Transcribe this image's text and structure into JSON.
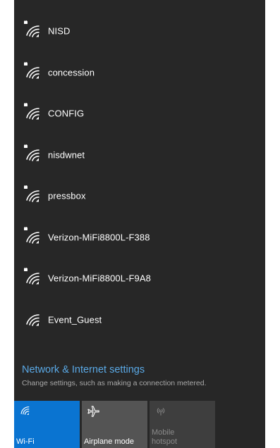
{
  "networks": [
    {
      "name": "NISD",
      "secured": true,
      "icon": "wifi-lock-icon"
    },
    {
      "name": "concession",
      "secured": true,
      "icon": "wifi-lock-icon"
    },
    {
      "name": "CONFIG",
      "secured": true,
      "icon": "wifi-lock-icon"
    },
    {
      "name": "nisdwnet",
      "secured": true,
      "icon": "wifi-lock-icon"
    },
    {
      "name": "pressbox",
      "secured": true,
      "icon": "wifi-lock-icon"
    },
    {
      "name": "Verizon-MiFi8800L-F388",
      "secured": true,
      "icon": "wifi-lock-icon"
    },
    {
      "name": "Verizon-MiFi8800L-F9A8",
      "secured": true,
      "icon": "wifi-lock-icon"
    },
    {
      "name": "Event_Guest",
      "secured": false,
      "icon": "wifi-icon"
    }
  ],
  "settings": {
    "link": "Network & Internet settings",
    "description": "Change settings, such as making a connection metered."
  },
  "quick_actions": {
    "wifi": {
      "label": "Wi-Fi",
      "active": true,
      "icon": "wifi-icon"
    },
    "airplane": {
      "label": "Airplane mode",
      "active": false,
      "icon": "airplane-icon"
    },
    "hotspot": {
      "label_line1": "Mobile",
      "label_line2": "hotspot",
      "enabled": false,
      "icon": "hotspot-icon"
    }
  },
  "colors": {
    "panel_bg": "#272727",
    "accent": "#0a74d1",
    "link": "#5aa9e6"
  }
}
